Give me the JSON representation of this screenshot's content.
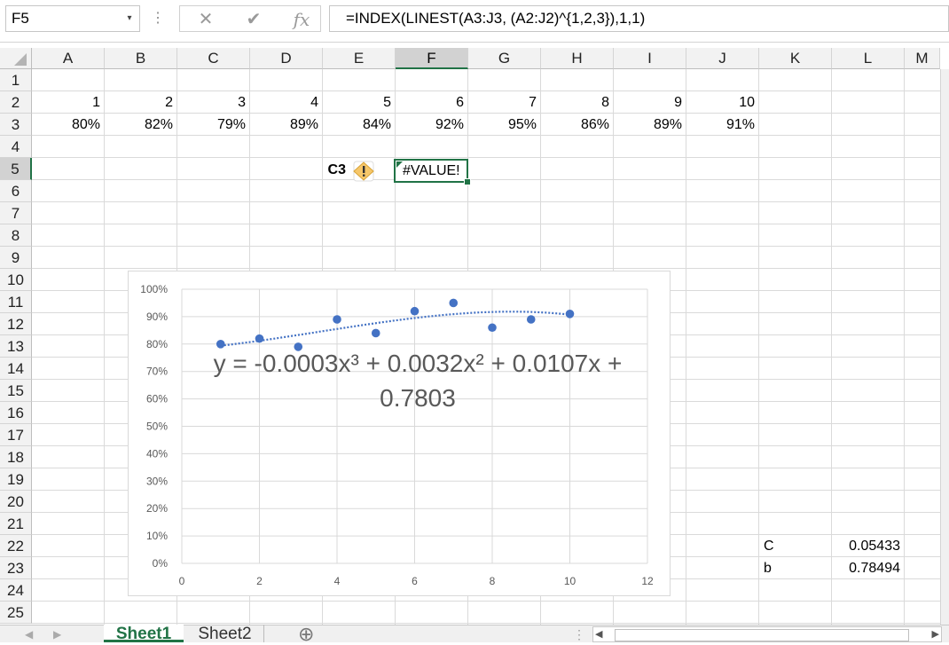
{
  "formula_bar": {
    "name_box": "F5",
    "dropdown_glyph": "▾",
    "dots_glyph": "⋮",
    "cancel_glyph": "✕",
    "enter_glyph": "✔",
    "fx_glyph": "fx",
    "formula": "=INDEX(LINEST(A3:J3, (A2:J2)^{1,2,3}),1,1)"
  },
  "columns": [
    "A",
    "B",
    "C",
    "D",
    "E",
    "F",
    "G",
    "H",
    "I",
    "J",
    "K",
    "L",
    "M"
  ],
  "selected_column": "F",
  "rows": [
    "1",
    "2",
    "3",
    "4",
    "5",
    "6",
    "7",
    "8",
    "9",
    "10",
    "11",
    "12",
    "13",
    "14",
    "15",
    "16",
    "17",
    "18",
    "19",
    "20",
    "21",
    "22",
    "23",
    "24",
    "25"
  ],
  "selected_row": "5",
  "cells": {
    "row2": [
      "1",
      "2",
      "3",
      "4",
      "5",
      "6",
      "7",
      "8",
      "9",
      "10"
    ],
    "row3": [
      "80%",
      "82%",
      "79%",
      "89%",
      "84%",
      "92%",
      "95%",
      "86%",
      "89%",
      "91%"
    ],
    "E5_label": "C3",
    "F5_value": "#VALUE!",
    "K22": "C",
    "L22": "0.05433",
    "K23": "b",
    "L23": "0.78494"
  },
  "warning_icon": "warning-diamond-icon",
  "chart_data": {
    "type": "scatter",
    "series": [
      {
        "x": [
          1,
          2,
          3,
          4,
          5,
          6,
          7,
          8,
          9,
          10
        ],
        "y": [
          0.8,
          0.82,
          0.79,
          0.89,
          0.84,
          0.92,
          0.95,
          0.86,
          0.89,
          0.91
        ]
      }
    ],
    "trendline": {
      "type": "polynomial",
      "order": 3,
      "coefficients": [
        -0.0003,
        0.0032,
        0.0107,
        0.7803
      ]
    },
    "equation_line1": "y = -0.0003x³ + 0.0032x² + 0.0107x +",
    "equation_line2": "0.7803",
    "x_ticks": [
      "0",
      "2",
      "4",
      "6",
      "8",
      "10",
      "12"
    ],
    "y_ticks": [
      "0%",
      "10%",
      "20%",
      "30%",
      "40%",
      "50%",
      "60%",
      "70%",
      "80%",
      "90%",
      "100%"
    ],
    "xlim": [
      0,
      12
    ],
    "ylim": [
      0,
      1
    ],
    "grid": true,
    "marker_color": "#4472c4",
    "trend_color": "#4472c4"
  },
  "sheets": {
    "tab1": "Sheet1",
    "tab2": "Sheet2",
    "add_glyph": "⊕"
  },
  "colors": {
    "accent": "#217346",
    "header_bg": "#f2f2f2"
  }
}
